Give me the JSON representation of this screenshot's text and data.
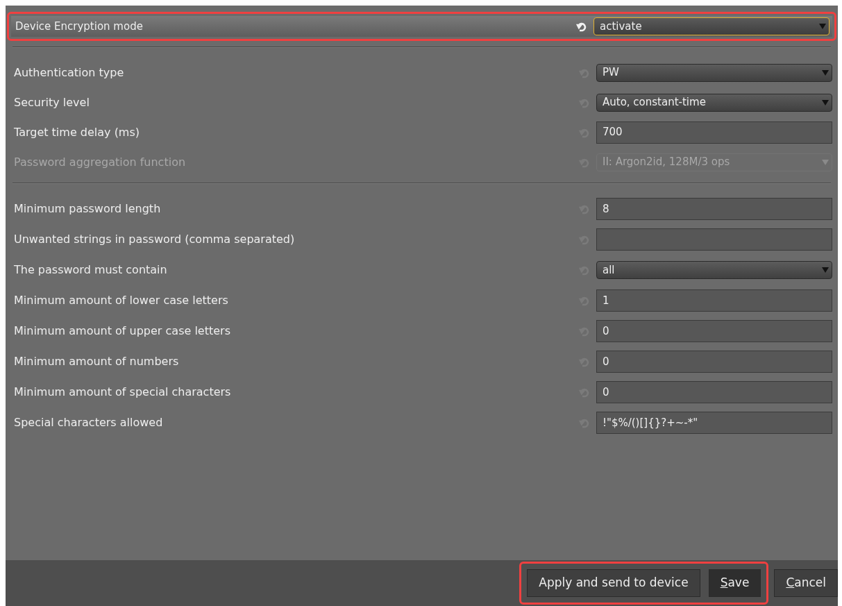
{
  "header": {
    "label": "Device Encryption mode",
    "kind": "select",
    "value": "activate",
    "reset_enabled": true,
    "highlighted": true
  },
  "groups": [
    {
      "rows": [
        {
          "label": "Authentication type",
          "kind": "select",
          "value": "PW",
          "disabled": false
        },
        {
          "label": "Security level",
          "kind": "select",
          "value": "Auto, constant-time",
          "disabled": false
        },
        {
          "label": "Target time delay (ms)",
          "kind": "text",
          "value": "700",
          "disabled": false
        },
        {
          "label": "Password aggregation function",
          "kind": "select",
          "value": "II: Argon2id, 128M/3 ops",
          "disabled": true
        }
      ]
    },
    {
      "rows": [
        {
          "label": "Minimum password length",
          "kind": "text",
          "value": "8",
          "disabled": false
        },
        {
          "label": "Unwanted strings in password (comma separated)",
          "kind": "text",
          "value": "",
          "disabled": false
        },
        {
          "label": "The password must contain",
          "kind": "select",
          "value": "all",
          "disabled": false
        },
        {
          "label": "Minimum amount of lower case letters",
          "kind": "text",
          "value": "1",
          "disabled": false
        },
        {
          "label": "Minimum amount of upper case letters",
          "kind": "text",
          "value": "0",
          "disabled": false
        },
        {
          "label": "Minimum amount of numbers",
          "kind": "text",
          "value": "0",
          "disabled": false
        },
        {
          "label": "Minimum amount of special characters",
          "kind": "text",
          "value": "0",
          "disabled": false
        },
        {
          "label": "Special characters allowed",
          "kind": "text",
          "value": "!\"$%/()[]{}?+~-*\"",
          "disabled": false
        }
      ]
    }
  ],
  "footer": {
    "highlighted": true,
    "buttons": [
      {
        "rest": "Apply and send to device",
        "default": false
      },
      {
        "mnemonic": "S",
        "rest": "ave",
        "default": true
      },
      {
        "mnemonic": "C",
        "rest": "ancel",
        "default": false
      }
    ]
  }
}
